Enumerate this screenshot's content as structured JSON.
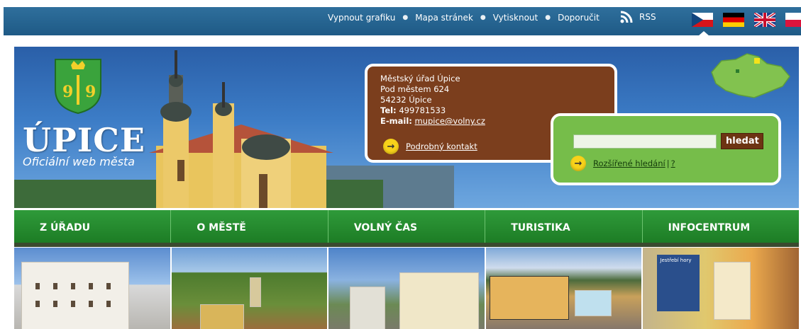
{
  "topbar": {
    "links": [
      "Vypnout grafiku",
      "Mapa stránek",
      "Vytisknout",
      "Doporučit"
    ],
    "rss_label": "RSS",
    "languages": [
      "cz",
      "de",
      "gb",
      "pl"
    ]
  },
  "header": {
    "city_name": "ÚPICE",
    "subtitle": "Oficiální web města"
  },
  "contact": {
    "office": "Městský úřad Úpice",
    "street": "Pod městem 624",
    "city": "54232 Úpice",
    "tel_label": "Tel:",
    "tel": "499781533",
    "email_label": "E-mail:",
    "email": "mupice@volny.cz",
    "detail_link": "Podrobný kontakt"
  },
  "search": {
    "placeholder": "",
    "button_label": "hledat",
    "advanced_link": "Rozšířené hledání",
    "separator": "|",
    "help_link": "?"
  },
  "nav": {
    "items": [
      "Z ÚŘADU",
      "O MĚSTĚ",
      "VOLNÝ ČAS",
      "TURISTIKA",
      "INFOCENTRUM"
    ]
  },
  "colors": {
    "topbar": "#24628f",
    "nav_green": "#23882c",
    "contact_brown": "#7b3e1d",
    "search_green": "#76bd4a",
    "search_button": "#6d3413",
    "link_arrow": "#f7d21a"
  },
  "photo_sign_text": "Jestřebí hory"
}
